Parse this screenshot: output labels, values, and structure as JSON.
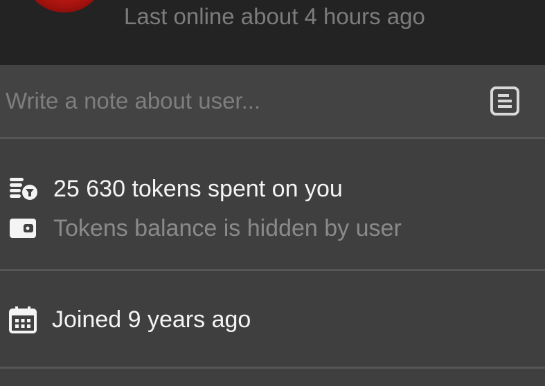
{
  "profile": {
    "last_online": "Last online about 4 hours ago"
  },
  "note": {
    "placeholder": "Write a note about user...",
    "icon": "note-icon"
  },
  "tokens": {
    "spent_text": "25 630 tokens spent on you",
    "spent_icon": "coins-icon",
    "balance_text": "Tokens balance is hidden by user",
    "balance_icon": "wallet-icon"
  },
  "joined": {
    "text": "Joined 9 years ago",
    "icon": "calendar-icon"
  },
  "colors": {
    "header_bg": "#232323",
    "panel_bg": "#3f3f3f",
    "divider": "#565656",
    "primary_text": "#f4f4f4",
    "muted_text": "#8a8a8a"
  }
}
